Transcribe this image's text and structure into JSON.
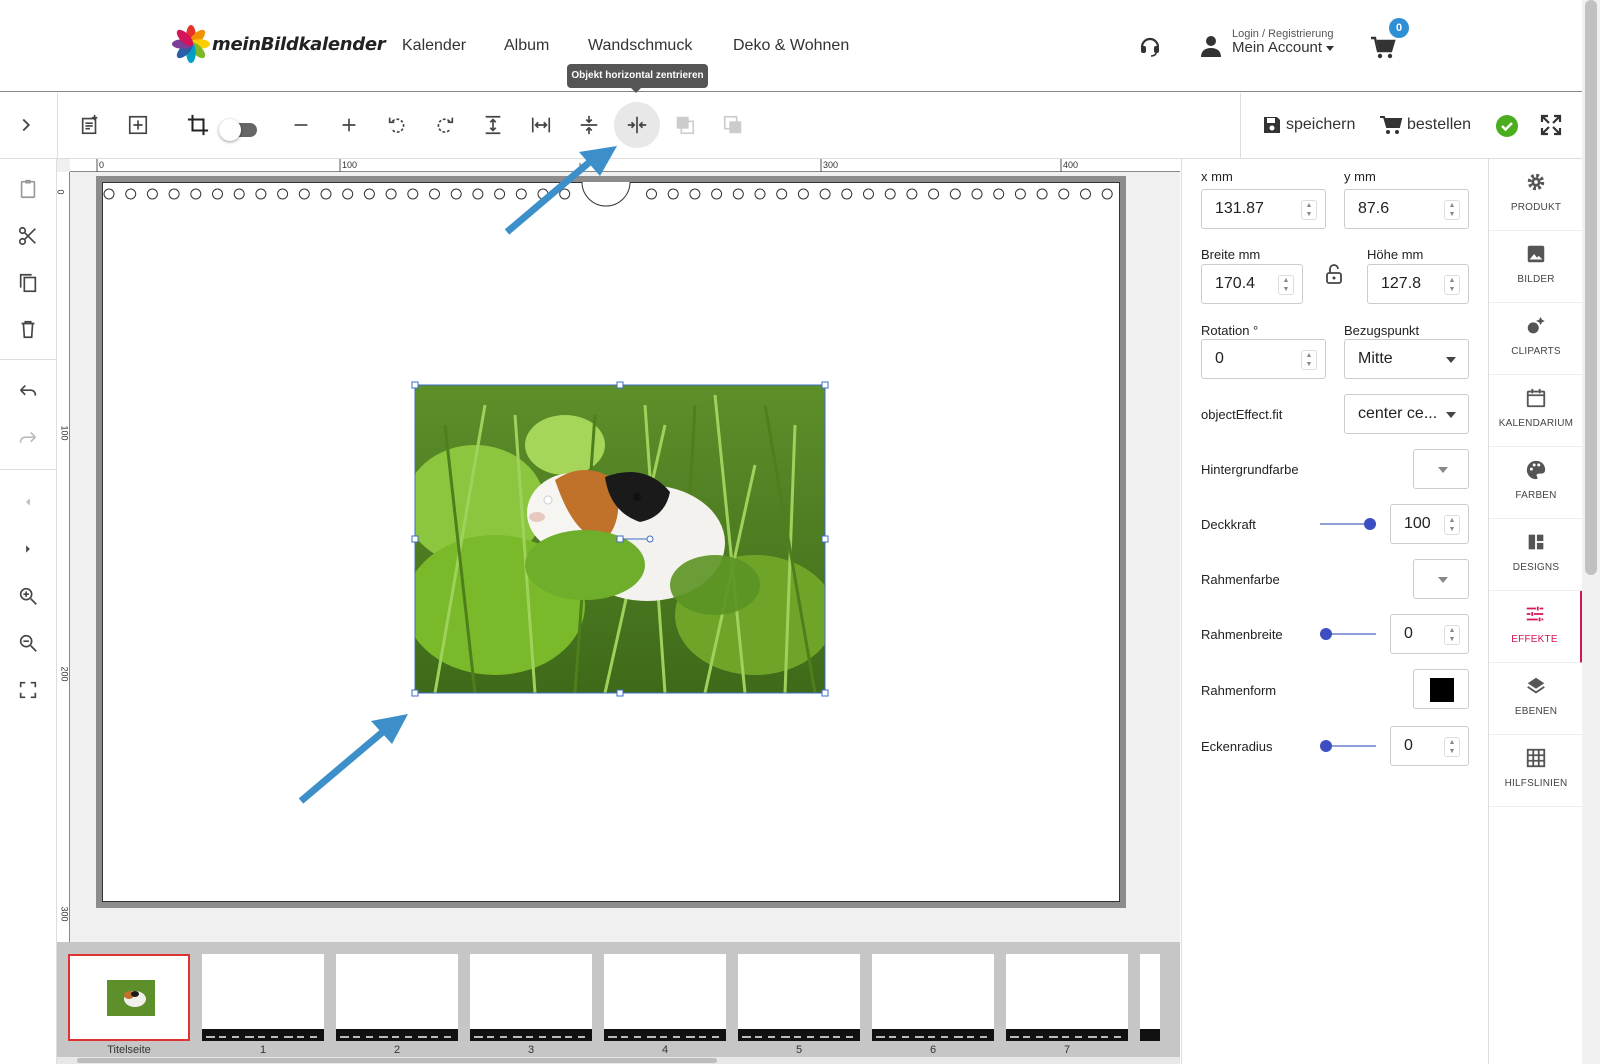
{
  "header": {
    "brand": "meinBildkalender",
    "nav": [
      "Kalender",
      "Album",
      "Wandschmuck",
      "Deko & Wohnen"
    ],
    "login_small": "Login / Registrierung",
    "account_label": "Mein Account",
    "cart_count": "0"
  },
  "tooltip": "Objekt horizontal zentrieren",
  "toolbar": {
    "save_label": "speichern",
    "order_label": "bestellen",
    "icons": [
      "add-page-icon",
      "add-frame-icon",
      "crop-icon",
      "zoom-out-icon",
      "zoom-in-icon",
      "rotate-left-icon",
      "rotate-right-icon",
      "align-vertical-fit-icon",
      "fit-width-icon",
      "center-vertical-icon",
      "center-horizontal-icon",
      "send-backward-icon",
      "bring-forward-icon"
    ]
  },
  "ruler": {
    "h_ticks": [
      "0",
      "100",
      "300",
      "400"
    ],
    "v_ticks": [
      "0",
      "100",
      "200",
      "300"
    ]
  },
  "properties": {
    "x_label": "x mm",
    "x_value": "131.87",
    "y_label": "y mm",
    "y_value": "87.6",
    "width_label": "Breite mm",
    "width_value": "170.4",
    "height_label": "Höhe mm",
    "height_value": "127.8",
    "rotation_label": "Rotation °",
    "rotation_value": "0",
    "anchor_label": "Bezugspunkt",
    "anchor_value": "Mitte",
    "fit_label": "objectEffect.fit",
    "fit_value": "center ce...",
    "bg_color_label": "Hintergrundfarbe",
    "opacity_label": "Deckkraft",
    "opacity_value": "100",
    "border_color_label": "Rahmenfarbe",
    "border_width_label": "Rahmenbreite",
    "border_width_value": "0",
    "border_shape_label": "Rahmenform",
    "corner_radius_label": "Eckenradius",
    "corner_radius_value": "0"
  },
  "rail": {
    "tabs": [
      "PRODUKT",
      "BILDER",
      "CLIPARTS",
      "KALENDARIUM",
      "FARBEN",
      "DESIGNS",
      "EFFEKTE",
      "EBENEN",
      "HILFSLINIEN"
    ],
    "active": "EFFEKTE"
  },
  "filmstrip": {
    "pages": [
      "Titelseite",
      "1",
      "2",
      "3",
      "4",
      "5",
      "6",
      "7"
    ]
  },
  "colors": {
    "accent_blue": "#2f8fd4",
    "arrow_blue": "#3d8fc9",
    "active_tab": "#d4145a",
    "slider": "#3d4fc0",
    "check_green": "#4cae1f"
  }
}
